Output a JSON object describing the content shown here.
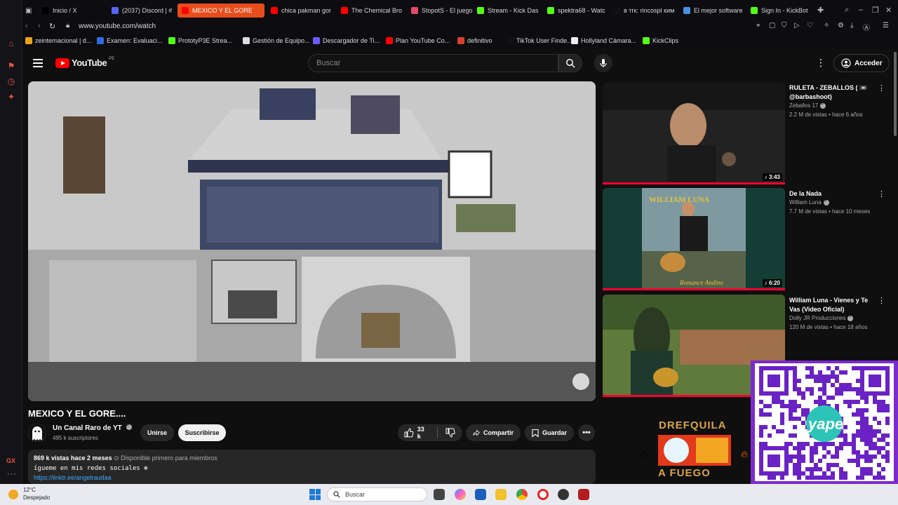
{
  "tabs": [
    {
      "label": "Inicio / X",
      "icon": "x-logo-icon",
      "color": "#000000"
    },
    {
      "label": "(2037) Discord | #",
      "icon": "discord-icon",
      "color": "#5865f2"
    },
    {
      "label": "MEXICO Y EL GORE",
      "icon": "youtube-icon",
      "color": "#ff0000"
    },
    {
      "label": "chica pakman gor",
      "icon": "youtube-icon",
      "color": "#ff0000"
    },
    {
      "label": "The Chemical Bro",
      "icon": "youtube-icon",
      "color": "#ff0000"
    },
    {
      "label": "StopotS - El juego",
      "icon": "stopots-icon",
      "color": "#e24a6a"
    },
    {
      "label": "Stream - Kick Das",
      "icon": "kick-icon",
      "color": "#53fc18"
    },
    {
      "label": "spektra68 - Watc",
      "icon": "kick-icon",
      "color": "#53fc18"
    },
    {
      "label": "в тгк: rincospl ким",
      "icon": "tiktok-icon",
      "color": "#111111"
    },
    {
      "label": "El mejor software",
      "icon": "software-icon",
      "color": "#4a90e2"
    },
    {
      "label": "Sign In - KickBot",
      "icon": "kick-icon",
      "color": "#53fc18"
    }
  ],
  "address": {
    "url": "www.youtube.com/watch"
  },
  "bookmarks": [
    {
      "label": "zeinternacional | d...",
      "color": "#e8a317"
    },
    {
      "label": "Examen: Evaluaci...",
      "color": "#2d6cdf"
    },
    {
      "label": "PrototyP3E Strea...",
      "color": "#53fc18"
    },
    {
      "label": "Gestión de Equipo...",
      "color": "#dddddd"
    },
    {
      "label": "Descargador de Ti...",
      "color": "#6a5cff"
    },
    {
      "label": "Plan YouTube Co...",
      "color": "#ff0000"
    },
    {
      "label": "definitivo",
      "color": "#d9402b"
    },
    {
      "label": "TikTok User Finde...",
      "color": "#111111"
    },
    {
      "label": "Hollyland Cámara...",
      "color": "#eeeeee"
    },
    {
      "label": "KickClips",
      "color": "#53fc18"
    }
  ],
  "youtube": {
    "logo_text": "YouTube",
    "country_code": "PE",
    "search_placeholder": "Buscar",
    "signin_label": "Acceder"
  },
  "video": {
    "title": "MEXICO Y EL GORE....",
    "channel": "Un Canal Raro de YT",
    "subscribers": "495 k suscriptores",
    "join_label": "Unirse",
    "subscribe_label": "Suscribirse",
    "likes": "33 k",
    "share_label": "Compartir",
    "save_label": "Guardar",
    "views_line": "869 k vistas  hace 2 meses",
    "members_note": "Disponible primero para miembros",
    "desc_line": "ígueme en mis redes sociales ✻",
    "desc_link": "https://linktr.ee/angelraudaa"
  },
  "recommendations": [
    {
      "title": "RULETA - ZEBALLOS ( 📼 @barbashoot)",
      "channel": "Zeballos 17",
      "views": "2.2 M de vistas • hace 6 años",
      "duration": "3:43"
    },
    {
      "title": "De la Nada",
      "channel": "William Luna",
      "views": "7.7 M de vistas • hace 10 meses",
      "duration": "6:20",
      "thumb_text_top": "WILLIAM LUNA",
      "thumb_text_bottom": "Romance Andino"
    },
    {
      "title": "William Luna - Vienes y Te Vas (Video Oficial)",
      "channel": "Dolly JR Producciones",
      "views": "120 M de vistas • hace 18 años",
      "duration": ""
    }
  ],
  "overlay": {
    "promo_top": "DREFQUILA",
    "promo_bottom": "A FUEGO",
    "qr_brand": "yape"
  },
  "sidebar": {
    "gx_label": "GX"
  },
  "taskbar": {
    "temp": "12°C",
    "condition": "Despejado",
    "search_placeholder": "Buscar"
  },
  "colors": {
    "accent": "#e84d1c",
    "youtube_red": "#ff0000",
    "link": "#3ea6ff"
  }
}
